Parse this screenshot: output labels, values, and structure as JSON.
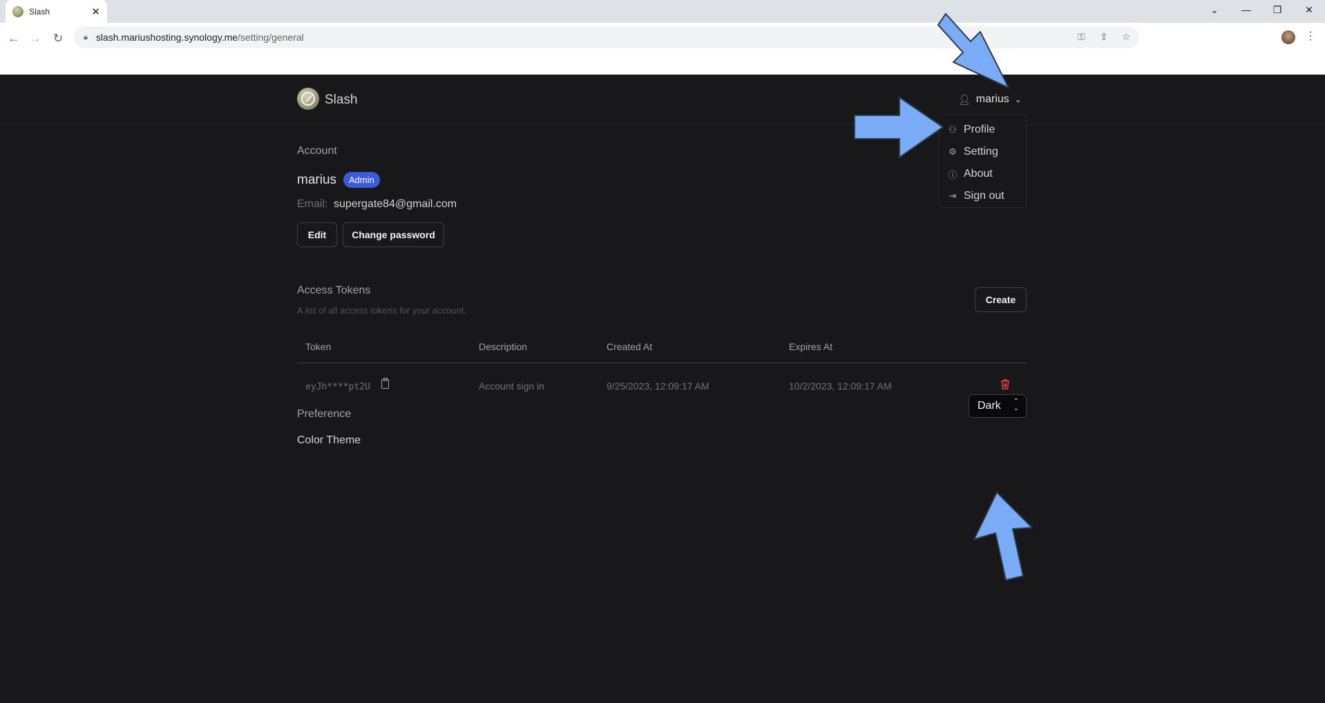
{
  "browser": {
    "tab_title": "Slash",
    "tab_close": "✕",
    "url_host": "slash.mariushosting.synology.me",
    "url_path": "/setting/general",
    "window_controls": [
      "⌄",
      "—",
      "❐",
      "✕"
    ]
  },
  "header": {
    "brand": "Slash",
    "username": "marius"
  },
  "user_dropdown": {
    "items": [
      {
        "label": "Profile",
        "icon": "user-icon"
      },
      {
        "label": "Setting",
        "icon": "gear-icon"
      },
      {
        "label": "About",
        "icon": "info-icon"
      },
      {
        "label": "Sign out",
        "icon": "sign-out-icon"
      }
    ]
  },
  "account": {
    "title": "Account",
    "name": "marius",
    "badge": "Admin",
    "email_label": "Email:",
    "email": "supergate84@gmail.com",
    "edit_label": "Edit",
    "change_password_label": "Change password"
  },
  "tokens": {
    "title": "Access Tokens",
    "subtitle": "A list of all access tokens for your account.",
    "create_label": "Create",
    "columns": [
      "Token",
      "Description",
      "Created At",
      "Expires At"
    ],
    "rows": [
      {
        "token": "eyJh****pt2U",
        "description": "Account sign in",
        "created": "9/25/2023, 12:09:17 AM",
        "expires": "10/2/2023, 12:09:17 AM"
      }
    ]
  },
  "preference": {
    "title": "Preference",
    "color_theme_label": "Color Theme",
    "color_theme_value": "Dark"
  },
  "colors": {
    "background": "#18181b",
    "accent": "#3b5bdb",
    "annotation_arrow": "#7aabf7",
    "danger": "#ef4444"
  }
}
